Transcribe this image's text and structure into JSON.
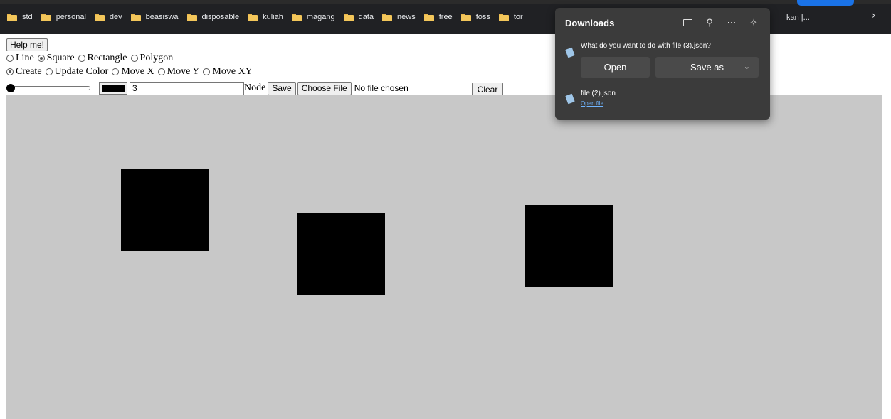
{
  "bookmarks": [
    {
      "label": "std"
    },
    {
      "label": "personal"
    },
    {
      "label": "dev"
    },
    {
      "label": "beasiswa"
    },
    {
      "label": "disposable"
    },
    {
      "label": "kuliah"
    },
    {
      "label": "magang"
    },
    {
      "label": "data"
    },
    {
      "label": "news"
    },
    {
      "label": "free"
    },
    {
      "label": "foss"
    },
    {
      "label": "tor"
    }
  ],
  "bookmarks_tail": "kan |...",
  "toolbar": {
    "help_label": "Help me!",
    "shape_options": [
      {
        "label": "Line",
        "checked": false
      },
      {
        "label": "Square",
        "checked": true
      },
      {
        "label": "Rectangle",
        "checked": false
      },
      {
        "label": "Polygon",
        "checked": false
      }
    ],
    "mode_options": [
      {
        "label": "Create",
        "checked": true
      },
      {
        "label": "Update Color",
        "checked": false
      },
      {
        "label": "Move X",
        "checked": false
      },
      {
        "label": "Move Y",
        "checked": false
      },
      {
        "label": "Move XY",
        "checked": false
      }
    ],
    "slider_value": 0,
    "color_value": "#000000",
    "text_value": "3",
    "node_label": "Node",
    "save_label": "Save",
    "choose_file_label": "Choose File",
    "file_status": "No file chosen",
    "clear_label": "Clear"
  },
  "canvas": {
    "background": "#c8c8c8",
    "shape_color": "#000000",
    "shapes": [
      {
        "type": "square"
      },
      {
        "type": "square"
      },
      {
        "type": "square"
      }
    ]
  },
  "downloads": {
    "title": "Downloads",
    "icons": [
      "folder-icon",
      "search-icon",
      "more-icon",
      "pin-icon"
    ],
    "prompt": "What do you want to do with file (3).json?",
    "open_label": "Open",
    "save_as_label": "Save as",
    "file_name": "file (2).json",
    "open_file_label": "Open file"
  }
}
